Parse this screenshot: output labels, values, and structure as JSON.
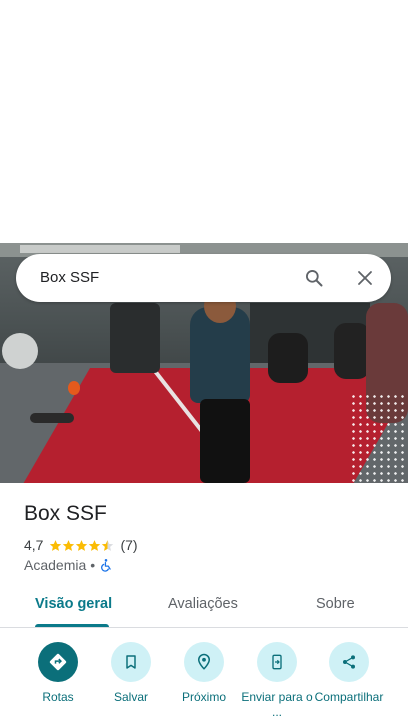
{
  "search": {
    "query": "Box SSF"
  },
  "place": {
    "name": "Box SSF",
    "rating": "4,7",
    "stars": 4.5,
    "reviews": "(7)",
    "category": "Academia",
    "separator": "•"
  },
  "tabs": [
    {
      "label": "Visão geral",
      "active": true
    },
    {
      "label": "Avaliações",
      "active": false
    },
    {
      "label": "Sobre",
      "active": false
    }
  ],
  "actions": [
    {
      "label": "Rotas",
      "icon": "directions-icon"
    },
    {
      "label": "Salvar",
      "icon": "bookmark-icon"
    },
    {
      "label": "Próximo",
      "icon": "nearby-icon"
    },
    {
      "label": "Enviar para o ...",
      "icon": "send-to-phone-icon"
    },
    {
      "label": "Compartilhar",
      "icon": "share-icon"
    }
  ],
  "colors": {
    "accent": "#0b7a8a",
    "action_bg": "#cff1f6",
    "star": "#fbbc04"
  }
}
